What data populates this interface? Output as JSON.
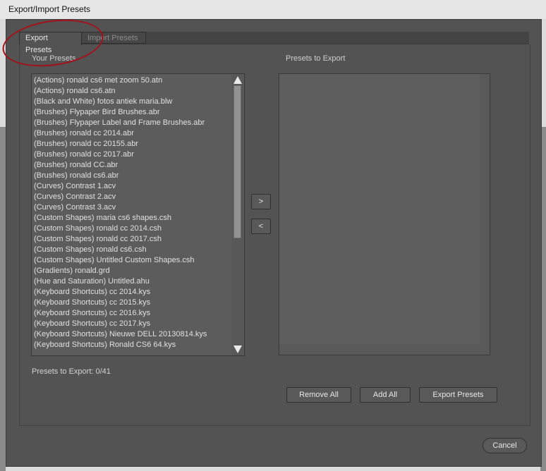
{
  "window": {
    "title": "Export/Import Presets"
  },
  "tabs": [
    {
      "label": "Export Presets"
    },
    {
      "label": "Import Presets"
    }
  ],
  "left_panel": {
    "label": "Your Presets",
    "items": [
      "(Actions)  ronald cs6 met zoom 50.atn",
      "(Actions)  ronald cs6.atn",
      "(Black and White)  fotos antiek maria.blw",
      "(Brushes)  Flypaper Bird Brushes.abr",
      "(Brushes)  Flypaper Label and Frame Brushes.abr",
      "(Brushes)  ronald cc 2014.abr",
      "(Brushes)  ronald cc 20155.abr",
      "(Brushes)  ronald cc 2017.abr",
      "(Brushes)  ronald CC.abr",
      "(Brushes)  ronald cs6.abr",
      "(Curves)  Contrast 1.acv",
      "(Curves)  Contrast 2.acv",
      "(Curves)  Contrast 3.acv",
      "(Custom Shapes)  maria cs6 shapes.csh",
      "(Custom Shapes)  ronald cc 2014.csh",
      "(Custom Shapes)  ronald cc 2017.csh",
      "(Custom Shapes)  ronald cs6.csh",
      "(Custom Shapes)  Untitled Custom Shapes.csh",
      "(Gradients)  ronald.grd",
      "(Hue and Saturation)  Untitled.ahu",
      "(Keyboard Shortcuts)  cc 2014.kys",
      "(Keyboard Shortcuts)  cc 2015.kys",
      "(Keyboard Shortcuts)  cc 2016.kys",
      "(Keyboard Shortcuts)  cc 2017.kys",
      "(Keyboard Shortcuts)  Nieuwe DELL 20130814.kys",
      "(Keyboard Shortcuts)  Ronald CS6 64.kys"
    ]
  },
  "right_panel": {
    "label": "Presets to Export"
  },
  "transfer_buttons": {
    "add": ">",
    "remove": "<"
  },
  "status": {
    "count_text": "Presets to Export: 0/41"
  },
  "actions": {
    "remove_all": "Remove All",
    "add_all": "Add All",
    "export_presets": "Export Presets"
  },
  "footer": {
    "cancel": "Cancel"
  },
  "colors": {
    "panel_bg": "#535353",
    "highlight_circle": "#a3121a"
  }
}
